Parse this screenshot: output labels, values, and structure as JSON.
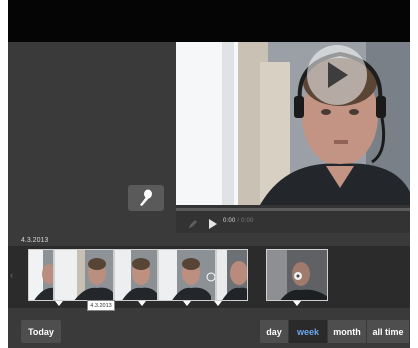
{
  "timeline": {
    "date": "4.3.2013",
    "tooltip": "4.3.2013"
  },
  "player": {
    "current_time": "0:00",
    "separator": " / ",
    "total_time": "0:00"
  },
  "buttons": {
    "today": "Today",
    "ranges": [
      "day",
      "week",
      "month",
      "all time"
    ],
    "active_range": "week"
  },
  "icons": {
    "play_overlay": "play-icon",
    "microphone": "microphone-icon",
    "pencil": "pencil-icon",
    "play_control": "play-control-icon"
  },
  "colors": {
    "active_range_text": "#6aa8ee",
    "panel_background": "#3a3a3a",
    "top_bar": "#050505"
  }
}
